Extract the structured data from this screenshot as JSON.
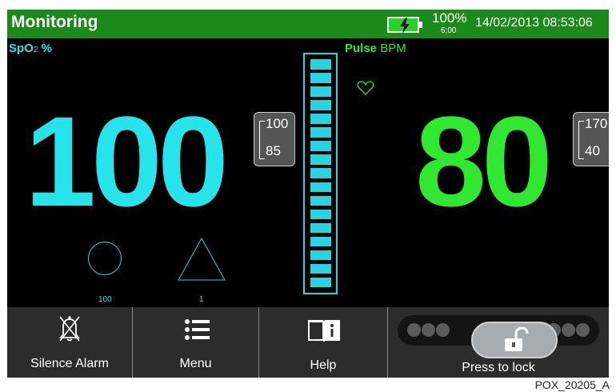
{
  "header": {
    "title": "Monitoring",
    "battery_percent": "100%",
    "battery_time": "6:00",
    "datetime": "14/02/2013 08:53:06",
    "battery_color": "#27d22b",
    "header_color": "#1b8a1b"
  },
  "spo2": {
    "label_main": "SpO",
    "label_sub": "2",
    "label_unit": " %",
    "value": "100",
    "limit_high": "100",
    "limit_low": "85",
    "color": "#27e4ea"
  },
  "pulse": {
    "label_main": "Pulse",
    "label_unit": " BPM",
    "value": "80",
    "limit_high": "170",
    "limit_low": "40",
    "color": "#2fe82f"
  },
  "indicators": {
    "circle_label": "100",
    "triangle_label": "1",
    "bargraph_segments": 17,
    "bargraph_level": 1.0
  },
  "footer": {
    "silence_alarm": "Silence Alarm",
    "menu": "Menu",
    "help": "Help",
    "press_to_lock": "Press to lock"
  },
  "icons": {
    "silence": "silenced-bell-icon",
    "menu": "menu-list-icon",
    "help": "help-book-icon",
    "lock": "unlocked-padlock-icon",
    "heart": "heart-icon",
    "battery": "battery-charging-icon"
  },
  "caption": "POX_20205_A"
}
